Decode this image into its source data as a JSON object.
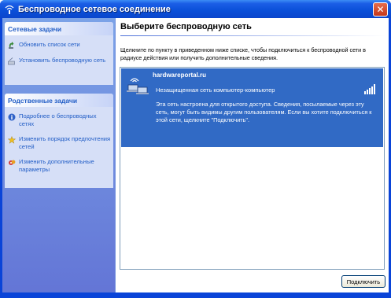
{
  "window": {
    "title": "Беспроводное сетевое соединение",
    "title_icon": "wireless-network-icon",
    "close_icon": "close-icon"
  },
  "sidebar": {
    "groups": [
      {
        "title": "Сетевые задачи",
        "items": [
          {
            "label": "Обновить список сети",
            "icon": "refresh-icon"
          },
          {
            "label": "Установить беспроводную сеть",
            "icon": "wizard-icon"
          }
        ]
      },
      {
        "title": "Родственные задачи",
        "items": [
          {
            "label": "Подробнее о беспроводных сетях",
            "icon": "info-icon"
          },
          {
            "label": "Изменить порядок предпочтения сетей",
            "icon": "star-icon"
          },
          {
            "label": "Изменить дополнительные параметры",
            "icon": "settings-icon"
          }
        ]
      }
    ]
  },
  "main": {
    "heading": "Выберите беспроводную сеть",
    "instructions": "Щелкните по пункту в приведенном ниже списке, чтобы подключиться к беспроводной сети в радиусе действия или получить дополнительные сведения.",
    "networks": [
      {
        "name": "hardwareportal.ru",
        "type": "Незащищенная сеть компьютер-компьютер",
        "description": "Эта сеть настроена для открытого доступа. Сведения, посылаемые через эту сеть, могут быть видимы другим пользователям. Если вы хотите подключиться к этой сети, щелкните \"Подключить\".",
        "signal_bars": 5,
        "selected": true
      }
    ],
    "connect_label": "Подключить"
  },
  "colors": {
    "titlebar": "#0a4fd8",
    "selection": "#316ac5",
    "sidebar_link": "#215dc6"
  }
}
